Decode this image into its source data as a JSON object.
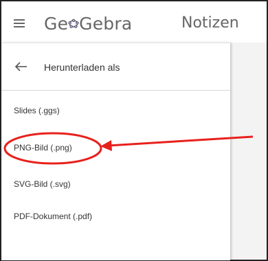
{
  "header": {
    "menu_icon": "hamburger-menu-icon",
    "logo_text_ge": "Ge",
    "logo_text_gebra": "Gebra",
    "app_name": "Notizen"
  },
  "panel": {
    "back_icon": "arrow-left-icon",
    "title": "Herunterladen als",
    "items": [
      {
        "label": "Slides (.ggs)"
      },
      {
        "label": "PNG-Bild (.png)"
      },
      {
        "label": "SVG-Bild (.svg)"
      },
      {
        "label": "PDF-Dokument (.pdf)"
      }
    ]
  },
  "annotation": {
    "color": "#e8201c",
    "highlighted_item": "PNG-Bild (.png)"
  },
  "colors": {
    "header_text": "#666666",
    "logo_accent": "#6557d2",
    "main_background": "#f3f3f3"
  }
}
